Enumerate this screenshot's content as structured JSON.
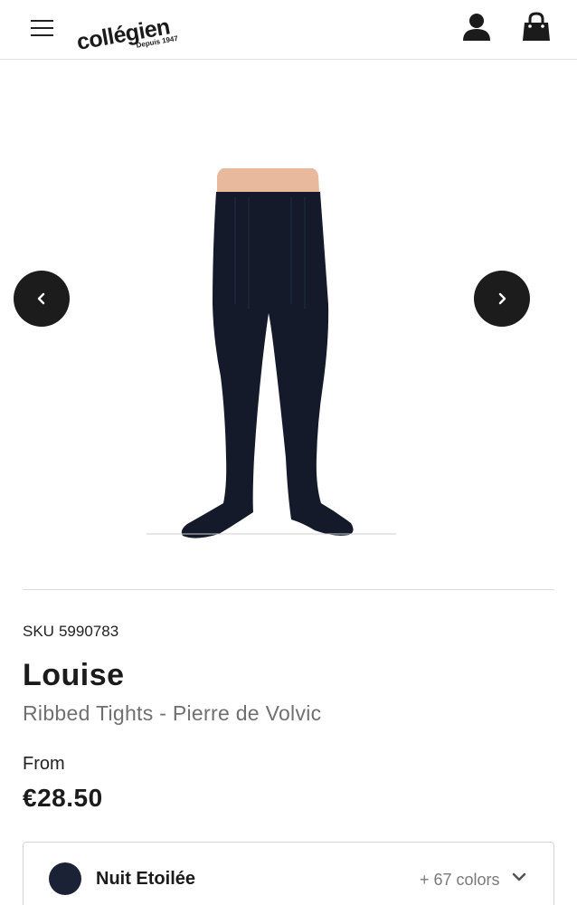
{
  "header": {
    "brand_name": "collégien",
    "brand_tagline": "Depuis 1947",
    "icons": [
      "hamburger-menu-icon",
      "user-icon",
      "shopping-bag-icon"
    ]
  },
  "gallery": {
    "image_subject": "navy ribbed tights",
    "prev_icon": "chevron-left-icon",
    "next_icon": "chevron-right-icon"
  },
  "product": {
    "sku_label": "SKU",
    "sku_value": "5990783",
    "name": "Louise",
    "subtitle": "Ribbed Tights - Pierre de Volvic",
    "price_prefix": "From",
    "price": "€28.50"
  },
  "color_selector": {
    "selected_color_name": "Nuit Etoilée",
    "selected_color_hex": "#1b2236",
    "more_colors_label": "+ 67 colors",
    "dropdown_icon": "chevron-down-icon"
  },
  "colors": {
    "accent_dark": "#1c1c1c",
    "subtitle_gray": "#707070"
  }
}
